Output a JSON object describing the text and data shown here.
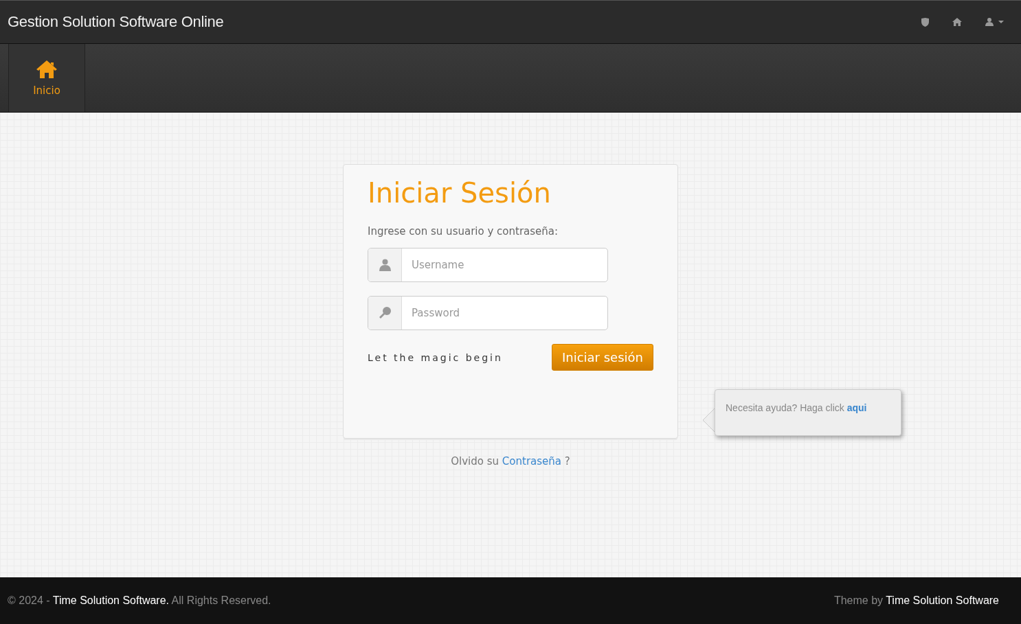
{
  "header": {
    "title": "Gestion Solution Software Online"
  },
  "nav": {
    "items": [
      {
        "label": "Inicio",
        "selected": true
      }
    ]
  },
  "login": {
    "title": "Iniciar Sesión",
    "subtitle": "Ingrese con su usuario y contraseña:",
    "username": {
      "placeholder": "Username"
    },
    "password": {
      "placeholder": "Password"
    },
    "tagline": "Let the magic begin",
    "submit": "Iniciar sesión"
  },
  "forgot": {
    "prefix": "Olvido su",
    "link": "Contraseña",
    "suffix": "?"
  },
  "help": {
    "text": "Necesita ayuda? Haga click",
    "link": "aqui"
  },
  "footer": {
    "left": {
      "prefix": "© 2024 -",
      "link": "Time Solution Software.",
      "suffix": "All Rights Reserved."
    },
    "right": {
      "prefix": "Theme by",
      "link": "Time Solution Software"
    }
  }
}
